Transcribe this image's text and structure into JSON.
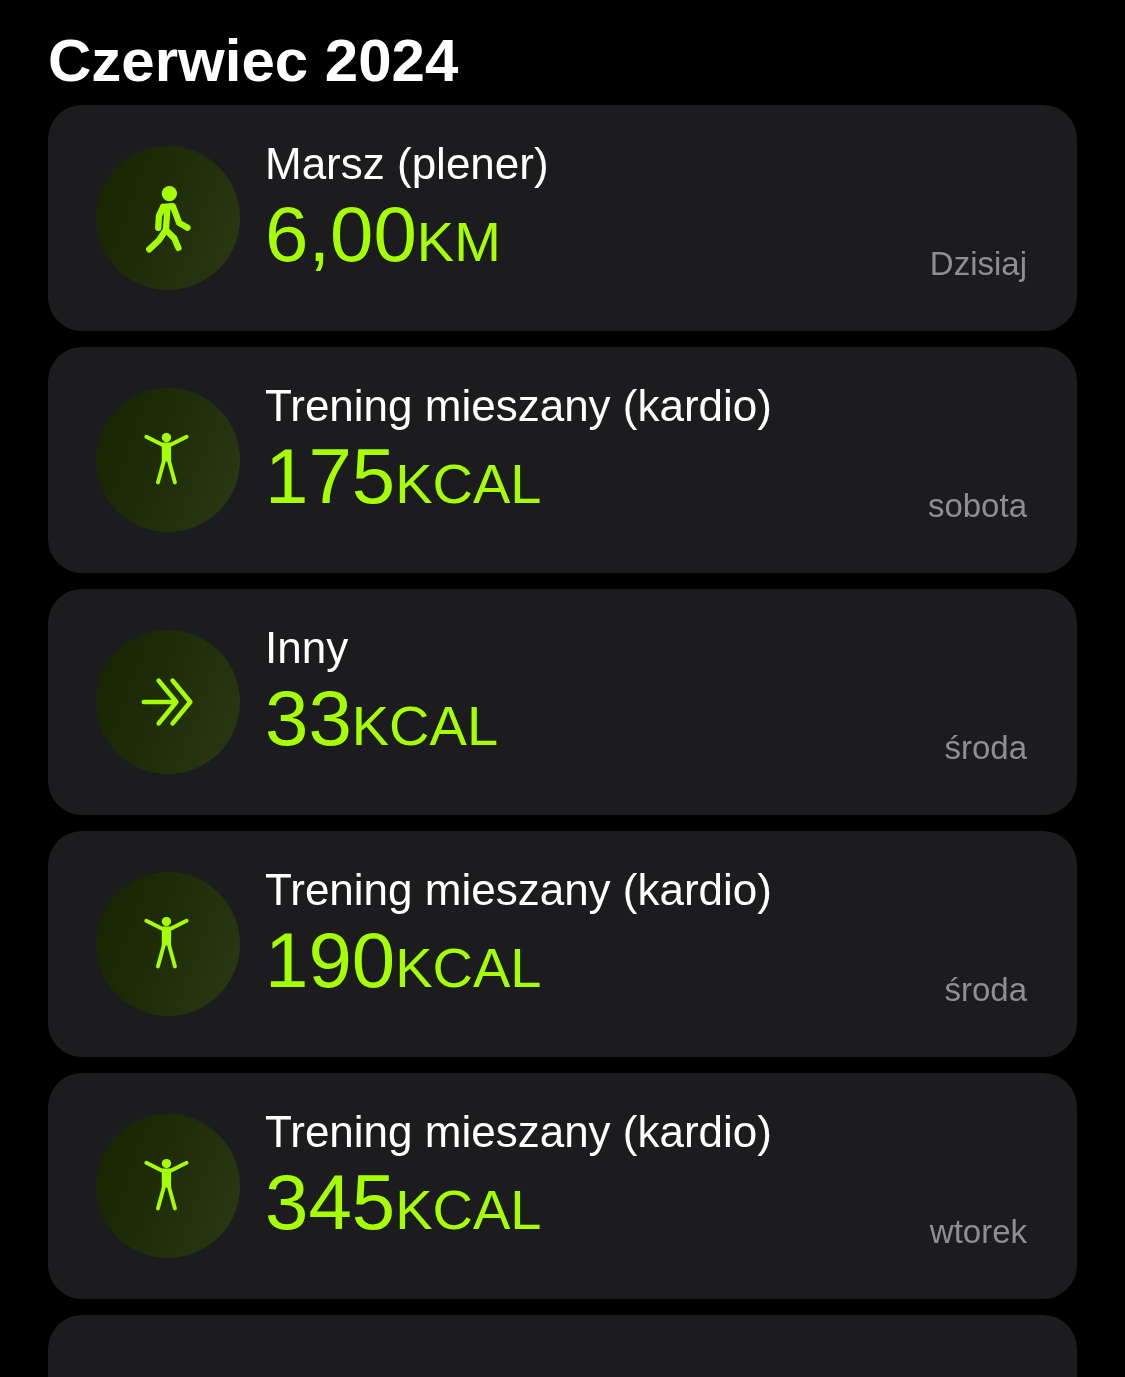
{
  "title": "Czerwiec 2024",
  "workouts": [
    {
      "kind": "walk",
      "name": "Marsz (plener)",
      "value": "6,00",
      "unit": "KM",
      "day": "Dzisiaj"
    },
    {
      "kind": "cardio",
      "name": "Trening mieszany (kardio)",
      "value": "175",
      "unit": "KCAL",
      "day": "sobota"
    },
    {
      "kind": "other",
      "name": "Inny",
      "value": "33",
      "unit": "KCAL",
      "day": "środa"
    },
    {
      "kind": "cardio",
      "name": "Trening mieszany (kardio)",
      "value": "190",
      "unit": "KCAL",
      "day": "środa"
    },
    {
      "kind": "cardio",
      "name": "Trening mieszany (kardio)",
      "value": "345",
      "unit": "KCAL",
      "day": "wtorek"
    }
  ]
}
